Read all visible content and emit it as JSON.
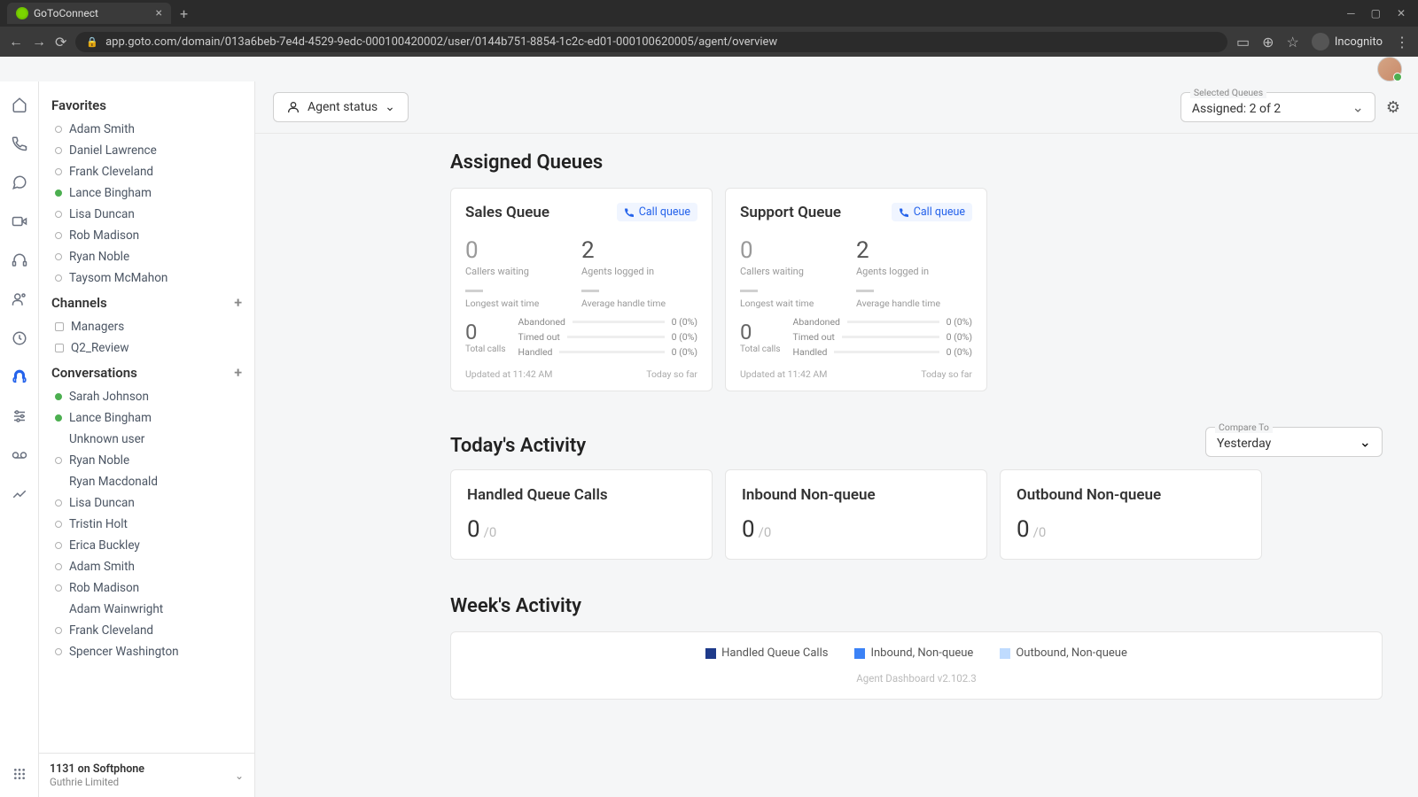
{
  "browser": {
    "tab_title": "GoToConnect",
    "url": "app.goto.com/domain/013a6beb-7e4d-4529-9edc-000100420002/user/0144b751-8854-1c2c-ed01-000100620005/agent/overview",
    "incognito_label": "Incognito"
  },
  "toolbar": {
    "agent_status": "Agent status",
    "selected_queues_label": "Selected Queues",
    "selected_queues_value": "Assigned: 2 of 2"
  },
  "sidebar": {
    "favorites_title": "Favorites",
    "favorites": [
      {
        "name": "Adam Smith",
        "status": "offline"
      },
      {
        "name": "Daniel Lawrence",
        "status": "offline"
      },
      {
        "name": "Frank Cleveland",
        "status": "offline"
      },
      {
        "name": "Lance Bingham",
        "status": "online"
      },
      {
        "name": "Lisa Duncan",
        "status": "offline"
      },
      {
        "name": "Rob Madison",
        "status": "offline"
      },
      {
        "name": "Ryan Noble",
        "status": "offline"
      },
      {
        "name": "Taysom McMahon",
        "status": "offline"
      }
    ],
    "channels_title": "Channels",
    "channels": [
      {
        "name": "Managers"
      },
      {
        "name": "Q2_Review"
      }
    ],
    "conversations_title": "Conversations",
    "conversations": [
      {
        "name": "Sarah Johnson",
        "status": "online"
      },
      {
        "name": "Lance Bingham",
        "status": "online"
      },
      {
        "name": "Unknown user",
        "status": "none"
      },
      {
        "name": "Ryan Noble",
        "status": "offline"
      },
      {
        "name": "Ryan Macdonald",
        "status": "none"
      },
      {
        "name": "Lisa Duncan",
        "status": "offline"
      },
      {
        "name": "Tristin Holt",
        "status": "offline"
      },
      {
        "name": "Erica Buckley",
        "status": "offline"
      },
      {
        "name": "Adam Smith",
        "status": "offline"
      },
      {
        "name": "Rob Madison",
        "status": "offline"
      },
      {
        "name": "Adam Wainwright",
        "status": "none"
      },
      {
        "name": "Frank Cleveland",
        "status": "offline"
      },
      {
        "name": "Spencer Washington",
        "status": "offline"
      }
    ],
    "footer_title": "1131 on Softphone",
    "footer_sub": "Guthrie Limited"
  },
  "assigned_queues": {
    "title": "Assigned Queues",
    "call_queue_label": "Call queue",
    "queues": [
      {
        "name": "Sales Queue",
        "callers_waiting": "0",
        "callers_waiting_lbl": "Callers waiting",
        "agents_logged": "2",
        "agents_logged_lbl": "Agents logged in",
        "longest_wait_lbl": "Longest wait time",
        "avg_handle_lbl": "Average handle time",
        "total_calls": "0",
        "total_calls_lbl": "Total calls",
        "abandoned_lbl": "Abandoned",
        "abandoned_val": "0 (0%)",
        "timed_out_lbl": "Timed out",
        "timed_out_val": "0 (0%)",
        "handled_lbl": "Handled",
        "handled_val": "0 (0%)",
        "updated": "Updated at 11:42 AM",
        "range": "Today so far"
      },
      {
        "name": "Support Queue",
        "callers_waiting": "0",
        "callers_waiting_lbl": "Callers waiting",
        "agents_logged": "2",
        "agents_logged_lbl": "Agents logged in",
        "longest_wait_lbl": "Longest wait time",
        "avg_handle_lbl": "Average handle time",
        "total_calls": "0",
        "total_calls_lbl": "Total calls",
        "abandoned_lbl": "Abandoned",
        "abandoned_val": "0 (0%)",
        "timed_out_lbl": "Timed out",
        "timed_out_val": "0 (0%)",
        "handled_lbl": "Handled",
        "handled_val": "0 (0%)",
        "updated": "Updated at 11:42 AM",
        "range": "Today so far"
      }
    ]
  },
  "today": {
    "title": "Today's Activity",
    "compare_label": "Compare To",
    "compare_value": "Yesterday",
    "cards": [
      {
        "title": "Handled Queue Calls",
        "val": "0",
        "sub": "/0"
      },
      {
        "title": "Inbound Non-queue",
        "val": "0",
        "sub": "/0"
      },
      {
        "title": "Outbound Non-queue",
        "val": "0",
        "sub": "/0"
      }
    ]
  },
  "week": {
    "title": "Week's Activity",
    "legend": [
      {
        "label": "Handled Queue Calls",
        "color": "#1e3a8a"
      },
      {
        "label": "Inbound, Non-queue",
        "color": "#3b82f6"
      },
      {
        "label": "Outbound, Non-queue",
        "color": "#bfdbfe"
      }
    ],
    "version": "Agent Dashboard v2.102.3"
  }
}
